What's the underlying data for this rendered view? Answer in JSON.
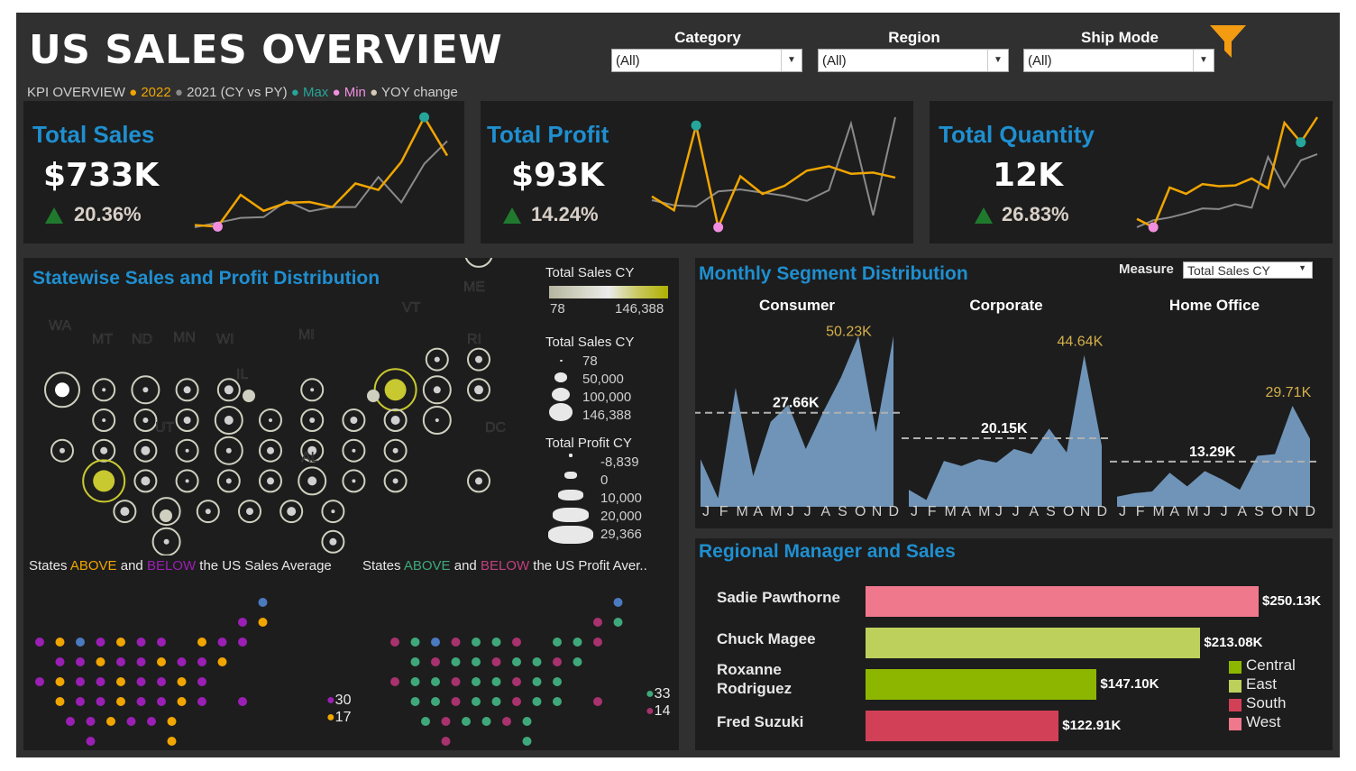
{
  "header": {
    "title": "US SALES OVERVIEW",
    "kpi_legend": {
      "prefix": "KPI OVERVIEW",
      "cy": "2022",
      "py": "2021",
      "cy_py": "(CY vs PY)",
      "max": "Max",
      "min": "Min",
      "yoy": "YOY change"
    },
    "filters": [
      {
        "label": "Category",
        "value": "(All)"
      },
      {
        "label": "Region",
        "value": "(All)"
      },
      {
        "label": "Ship Mode",
        "value": "(All)"
      }
    ]
  },
  "colors": {
    "cy": "#f0a500",
    "py": "#8a8a8a",
    "max": "#26a69a",
    "min": "#f28ee0",
    "accent": "#1f8fd0",
    "area": "#6f94b8",
    "central": "#8db600",
    "east": "#bdd05c",
    "south": "#d24057",
    "west": "#ef788c",
    "above_sales": "#f0a500",
    "below_sales": "#9b1fb5",
    "above_profit": "#3fa87a",
    "below_profit": "#a8326e",
    "dc": "#4a7ac0"
  },
  "kpis": [
    {
      "title": "Total Sales",
      "value": "$733K",
      "change": "20.36%"
    },
    {
      "title": "Total Profit",
      "value": "$93K",
      "change": "14.24%"
    },
    {
      "title": "Total Quantity",
      "value": "12K",
      "change": "26.83%"
    }
  ],
  "statewise": {
    "title": "Statewise Sales and Profit Distribution",
    "state_labels": [
      "WA",
      "MT",
      "ND",
      "MN",
      "WI",
      "MI",
      "VT",
      "ME",
      "RI",
      "IL",
      "UT",
      "AL",
      "DC"
    ],
    "legend_color": {
      "title": "Total Sales CY",
      "min": "78",
      "max": "146,388"
    },
    "legend_sales_size": {
      "title": "Total Sales CY",
      "values": [
        "78",
        "50,000",
        "100,000",
        "146,388"
      ]
    },
    "legend_profit_size": {
      "title": "Total Profit CY",
      "values": [
        "-8,839",
        "0",
        "10,000",
        "20,000",
        "29,366"
      ]
    }
  },
  "above_below": {
    "sales": {
      "prefix": "States ",
      "above": "ABOVE",
      "mid": " and ",
      "below": "BELOW",
      "suffix": " the US Sales Average",
      "count_below": "30",
      "count_above": "17"
    },
    "profit": {
      "prefix": "States ",
      "above": "ABOVE",
      "mid": " and ",
      "below": "BELOW",
      "suffix": " the US Profit Aver..",
      "count_above": "33",
      "count_below": "14"
    }
  },
  "monthly": {
    "title": "Monthly Segment Distribution",
    "measure_label": "Measure",
    "measure_value": "Total Sales CY",
    "month_letters": [
      "J",
      "F",
      "M",
      "A",
      "M",
      "J",
      "J",
      "A",
      "S",
      "O",
      "N",
      "D"
    ]
  },
  "regional": {
    "title": "Regional Manager and Sales",
    "legend": [
      "Central",
      "East",
      "South",
      "West"
    ]
  },
  "chart_data": [
    {
      "type": "line",
      "title": "Total Sales",
      "x": [
        "Jan",
        "Feb",
        "Mar",
        "Apr",
        "May",
        "Jun",
        "Jul",
        "Aug",
        "Sep",
        "Oct",
        "Nov",
        "Dec"
      ],
      "series": [
        {
          "name": "2022",
          "values": [
            19.9,
            18.4,
            47.3,
            32.8,
            40.1,
            40.8,
            36.2,
            57.7,
            51.9,
            77.3,
            117.9,
            83.0
          ]
        },
        {
          "name": "2021",
          "values": [
            17.9,
            22.0,
            26.4,
            27.1,
            41.8,
            32.4,
            36.3,
            36.2,
            63.5,
            40.5,
            75.5,
            96.2
          ]
        }
      ],
      "max_index": 10,
      "min_index": 1
    },
    {
      "type": "line",
      "title": "Total Profit",
      "x": [
        "Jan",
        "Feb",
        "Mar",
        "Apr",
        "May",
        "Jun",
        "Jul",
        "Aug",
        "Sep",
        "Oct",
        "Nov",
        "Dec"
      ],
      "series": [
        {
          "name": "2022",
          "values": [
            2.4,
            0.2,
            13.7,
            -2.5,
            5.6,
            2.8,
            4.1,
            6.5,
            7.2,
            6.0,
            6.2,
            5.4
          ]
        },
        {
          "name": "2021",
          "values": [
            1.8,
            1.0,
            0.8,
            3.2,
            3.5,
            3.0,
            2.5,
            1.7,
            3.4,
            14.0,
            -0.6,
            15.0
          ]
        }
      ],
      "max_index": 2,
      "min_index": 3
    },
    {
      "type": "line",
      "title": "Total Quantity",
      "x": [
        "Jan",
        "Feb",
        "Mar",
        "Apr",
        "May",
        "Jun",
        "Jul",
        "Aug",
        "Sep",
        "Oct",
        "Nov",
        "Dec"
      ],
      "series": [
        {
          "name": "2022",
          "values": [
            400,
            280,
            850,
            760,
            900,
            870,
            880,
            980,
            840,
            1780,
            1500,
            1860
          ]
        },
        {
          "name": "2021",
          "values": [
            280,
            380,
            420,
            480,
            550,
            540,
            610,
            560,
            1290,
            860,
            1240,
            1330
          ]
        }
      ],
      "max_index": 10,
      "min_index": 1
    },
    {
      "type": "area",
      "title": "Monthly Segment Distribution",
      "x": [
        "Jan",
        "Feb",
        "Mar",
        "Apr",
        "May",
        "Jun",
        "Jul",
        "Aug",
        "Sep",
        "Oct",
        "Nov",
        "Dec"
      ],
      "unit": "K",
      "series": [
        {
          "name": "Consumer",
          "values": [
            14.0,
            2.5,
            35.0,
            9.0,
            25.0,
            30.0,
            17.0,
            28.0,
            38.0,
            50.23,
            22.0,
            50.23
          ],
          "average": 27.66,
          "max_label": "50.23K",
          "avg_label": "27.66K"
        },
        {
          "name": "Corporate",
          "values": [
            5.0,
            2.0,
            13.5,
            12.0,
            14.0,
            13.0,
            17.0,
            15.5,
            23.0,
            16.0,
            44.64,
            18.0
          ],
          "average": 20.15,
          "max_label": "44.64K",
          "avg_label": "20.15K"
        },
        {
          "name": "Home Office",
          "values": [
            3.0,
            4.0,
            4.5,
            10.0,
            6.0,
            10.5,
            8.0,
            5.0,
            15.0,
            15.5,
            29.71,
            20.0
          ],
          "average": 13.29,
          "max_label": "29.71K",
          "avg_label": "13.29K"
        }
      ]
    },
    {
      "type": "bar",
      "title": "Regional Manager and Sales",
      "orientation": "horizontal",
      "categories": [
        "Sadie Pawthorne",
        "Chuck Magee",
        "Roxanne Rodriguez",
        "Fred Suzuki"
      ],
      "values": [
        250.13,
        213.08,
        147.1,
        122.91
      ],
      "value_labels": [
        "$250.13K",
        "$213.08K",
        "$147.10K",
        "$122.91K"
      ],
      "regions": [
        "West",
        "East",
        "Central",
        "South"
      ]
    }
  ]
}
